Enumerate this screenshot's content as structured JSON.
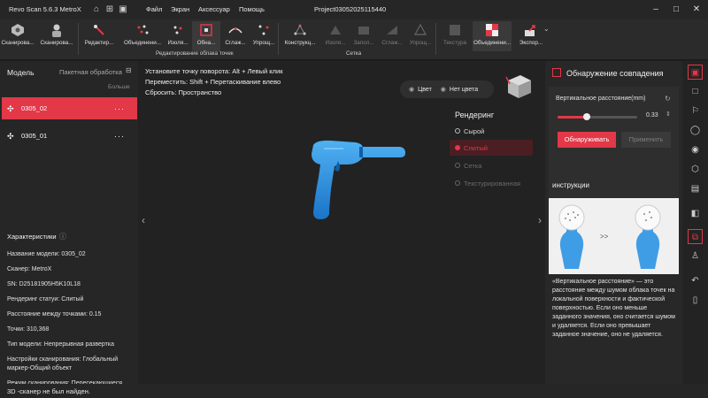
{
  "app": {
    "title": "Revo Scan 5.6.3 MetroX",
    "project": "Project03052025115440"
  },
  "menu": [
    "Файл",
    "Экран",
    "Аксессуар",
    "Помощь"
  ],
  "toolbar": {
    "tools": [
      {
        "label": "Сканирова...",
        "icon": "scanner-icon"
      },
      {
        "label": "Сканирова...",
        "icon": "person-scan-icon"
      },
      {
        "label": "Редактир...",
        "icon": "edit-brush-icon"
      },
      {
        "label": "Объединени...",
        "icon": "merge-icon"
      },
      {
        "label": "Изоля...",
        "icon": "isolate-icon"
      },
      {
        "label": "Обна...",
        "icon": "detect-icon"
      },
      {
        "label": "Сглаж...",
        "icon": "smooth-icon"
      },
      {
        "label": "Упрощ...",
        "icon": "simplify-icon"
      },
      {
        "label": "Конструкц...",
        "icon": "construct-icon"
      },
      {
        "label": "Изоля...",
        "icon": "isolate-mesh-icon"
      },
      {
        "label": "Запол...",
        "icon": "fill-holes-icon"
      },
      {
        "label": "Сглаж...",
        "icon": "smooth-mesh-icon"
      },
      {
        "label": "Упрощ...",
        "icon": "simplify-mesh-icon"
      },
      {
        "label": "Текстура",
        "icon": "texture-icon"
      },
      {
        "label": "Объединени...",
        "icon": "merge-texture-icon"
      },
      {
        "label": "Экспор...",
        "icon": "export-icon"
      }
    ],
    "group_pointcloud": "Редактирование облака точек",
    "group_mesh": "Сетка"
  },
  "left": {
    "model_title": "Модель",
    "batch": "Пакетная обработка",
    "more": "Больше",
    "models": [
      {
        "name": "0305_02",
        "selected": true
      },
      {
        "name": "0305_01",
        "selected": false
      }
    ],
    "props_title": "Характеристики",
    "props": [
      "Название модели: 0305_02",
      "Сканер: MetroX",
      "SN: D25181905H5K10L18",
      "Рендеринг статуи: Слитый",
      "Расстояние между точками: 0.15",
      "Точки: 310,368",
      "Тип модели: Непрерывная развертка",
      "Настройки сканирования: Глобальный маркер-Общий объект",
      "Режим сканирования: Пересекающиеся линии"
    ]
  },
  "viewport": {
    "hints": [
      "Установите точку поворота: Alt + Левый клик",
      "Переместить: Shift + Перетаскивание влево",
      "Сбросить: Пространство"
    ],
    "color_on": "Цвет",
    "color_off": "Нет цвета",
    "render_title": "Рендеринг",
    "render_options": [
      {
        "label": "Сырой",
        "state": "normal"
      },
      {
        "label": "Слитый",
        "state": "selected"
      },
      {
        "label": "Сетка",
        "state": "disabled"
      },
      {
        "label": "Текстурированная",
        "state": "disabled"
      }
    ]
  },
  "right": {
    "title": "Обнаружение совпадения",
    "slider_label": "Вертикальное расстояние(mm)",
    "slider_value": "0.33",
    "slider_fraction": 0.37,
    "detect_btn": "Обнаруживать",
    "apply_btn": "Применить",
    "instructions_title": "инструкции",
    "instructions_text": "«Вертикальное расстояние» — это расстояние между шумом облака точек на локальной поверхности и фактической поверхностью. Если оно меньше заданного значения, оно считается шумом и удаляется. Если оно превышает заданное значение, оно не удаляется."
  },
  "status": "3D -сканер не был найден.",
  "colors": {
    "accent": "#e23847",
    "model": "#1e88d8"
  }
}
